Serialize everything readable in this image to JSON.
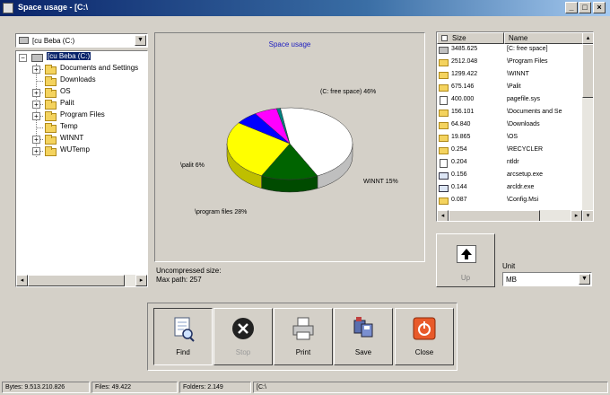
{
  "window": {
    "title": "Space usage - [C:\\",
    "controls": {
      "minimize": "_",
      "maximize": "□",
      "close": "×"
    }
  },
  "drive_select": {
    "value": "[cu Beba (C:)"
  },
  "tree": {
    "root": "[cu Beba (C:)",
    "items": [
      {
        "label": "Documents and Settings",
        "expandable": true
      },
      {
        "label": "Downloads",
        "expandable": false
      },
      {
        "label": "OS",
        "expandable": true
      },
      {
        "label": "Palit",
        "expandable": true
      },
      {
        "label": "Program Files",
        "expandable": true
      },
      {
        "label": "Temp",
        "expandable": false
      },
      {
        "label": "WINNT",
        "expandable": true
      },
      {
        "label": "WUTemp",
        "expandable": true
      }
    ]
  },
  "chart": {
    "title": "Space usage"
  },
  "chart_data": {
    "type": "pie",
    "title": "Space usage",
    "slices": [
      {
        "label": "(C: free space) 46%",
        "value": 46,
        "color": "#ffffff"
      },
      {
        "label": "WINNT 15%",
        "value": 15,
        "color": "#006400"
      },
      {
        "label": "\\program files 28%",
        "value": 28,
        "color": "#ffff00"
      },
      {
        "label": "",
        "value": 6,
        "color": "#0000ff"
      },
      {
        "label": "\\palit 6%",
        "value": 6,
        "color": "#ff00ff"
      },
      {
        "label": "",
        "value": 1,
        "color": "#008080"
      }
    ]
  },
  "chart_info": {
    "uncompressed": "Uncompressed size:",
    "max_path": "Max path: 257"
  },
  "file_list": {
    "columns": {
      "size": "Size",
      "name": "Name"
    },
    "rows": [
      {
        "icon": "drive",
        "size": "3485.625",
        "name": "[C: free space]"
      },
      {
        "icon": "folder",
        "size": "2512.048",
        "name": "\\Program Files"
      },
      {
        "icon": "folder",
        "size": "1299.422",
        "name": "\\WINNT"
      },
      {
        "icon": "folder",
        "size": "675.146",
        "name": "\\Palit"
      },
      {
        "icon": "file",
        "size": "400.000",
        "name": "pagefile.sys"
      },
      {
        "icon": "folder",
        "size": "156.101",
        "name": "\\Documents and Se"
      },
      {
        "icon": "folder",
        "size": "64.840",
        "name": "\\Downloads"
      },
      {
        "icon": "folder",
        "size": "19.865",
        "name": "\\OS"
      },
      {
        "icon": "folder",
        "size": "0.254",
        "name": "\\RECYCLER"
      },
      {
        "icon": "file",
        "size": "0.204",
        "name": "ntldr"
      },
      {
        "icon": "exe",
        "size": "0.156",
        "name": "arcsetup.exe"
      },
      {
        "icon": "exe",
        "size": "0.144",
        "name": "arcldr.exe"
      },
      {
        "icon": "folder",
        "size": "0.087",
        "name": "\\Config.Msi"
      }
    ]
  },
  "up_button": {
    "label": "Up"
  },
  "unit": {
    "label": "Unit",
    "value": "MB"
  },
  "actions": [
    {
      "id": "find",
      "label": "Find",
      "enabled": true
    },
    {
      "id": "stop",
      "label": "Stop",
      "enabled": false
    },
    {
      "id": "print",
      "label": "Print",
      "enabled": true
    },
    {
      "id": "save",
      "label": "Save",
      "enabled": true
    },
    {
      "id": "close",
      "label": "Close",
      "enabled": true
    }
  ],
  "status": {
    "bytes": "Bytes: 9.513.210.826",
    "files": "Files: 49.422",
    "folders": "Folders: 2.149",
    "path": "[C:\\"
  }
}
